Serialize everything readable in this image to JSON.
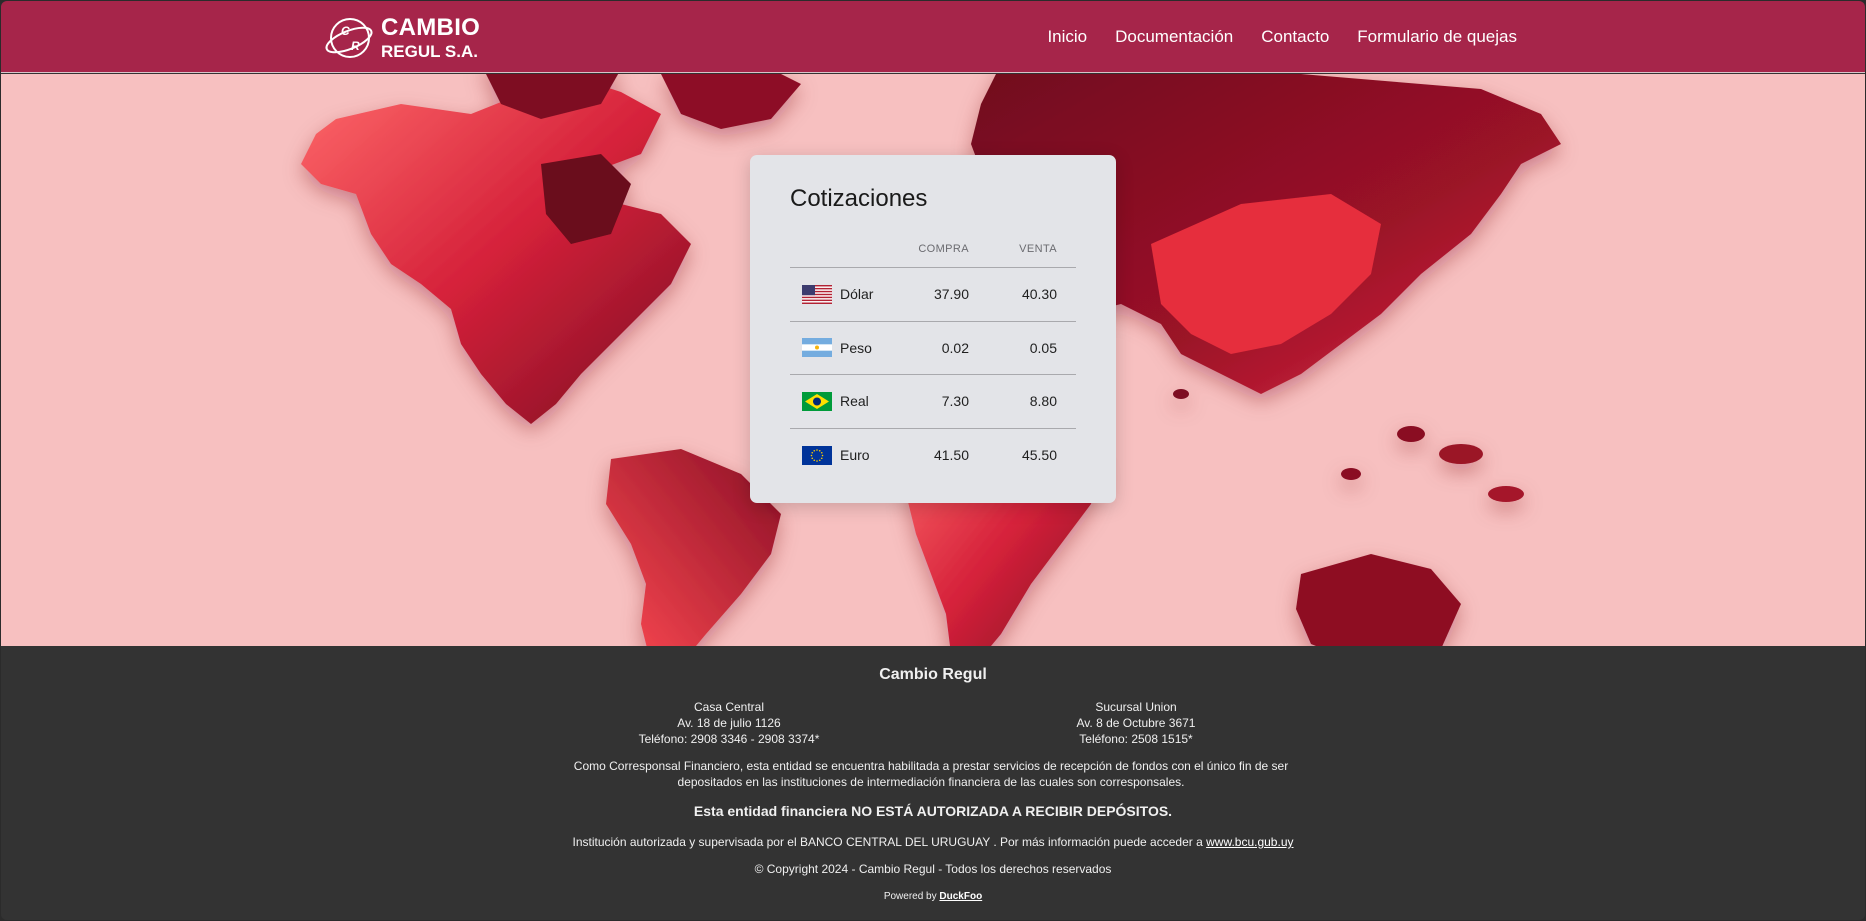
{
  "brand": {
    "logo_line1": "CAMBIO",
    "logo_line2": "REGUL S.A.",
    "logo_mark_letters": "C R",
    "header_color": "#a6254a"
  },
  "nav": {
    "items": [
      {
        "label": "Inicio"
      },
      {
        "label": "Documentación"
      },
      {
        "label": "Contacto"
      },
      {
        "label": "Formulario de quejas"
      }
    ]
  },
  "rates_card": {
    "title": "Cotizaciones",
    "headers": {
      "buy": "COMPRA",
      "sell": "VENTA"
    },
    "rows": [
      {
        "currency": "Dólar",
        "flag": "us-flag-icon",
        "buy": "37.90",
        "sell": "40.30"
      },
      {
        "currency": "Peso",
        "flag": "argentina-flag-icon",
        "buy": "0.02",
        "sell": "0.05"
      },
      {
        "currency": "Real",
        "flag": "brazil-flag-icon",
        "buy": "7.30",
        "sell": "8.80"
      },
      {
        "currency": "Euro",
        "flag": "eu-flag-icon",
        "buy": "41.50",
        "sell": "45.50"
      }
    ]
  },
  "footer": {
    "title": "Cambio Regul",
    "branch_a": {
      "name": "Casa Central",
      "address": "Av. 18 de julio 1126",
      "phone": "Teléfono: 2908 3346 - 2908 3374*"
    },
    "branch_b": {
      "name": "Sucursal Union",
      "address": "Av. 8 de Octubre 3671",
      "phone": "Teléfono: 2508 1515*"
    },
    "note": "Como Corresponsal Financiero, esta entidad se encuentra habilitada a prestar servicios de recepción de fondos con el único fin de ser depositados en las instituciones de intermediación financiera de las cuales son corresponsales.",
    "warning": "Esta entidad financiera NO ESTÁ AUTORIZADA A RECIBIR DEPÓSITOS.",
    "supervision_text": "Institución autorizada y supervisada por el BANCO CENTRAL DEL URUGUAY . Por más información puede acceder a",
    "supervision_link": "www.bcu.gub.uy",
    "copyright": "© Copyright 2024 - Cambio Regul - Todos los derechos reservados",
    "powered_text": "Powered by",
    "powered_link": "DuckFoo"
  }
}
